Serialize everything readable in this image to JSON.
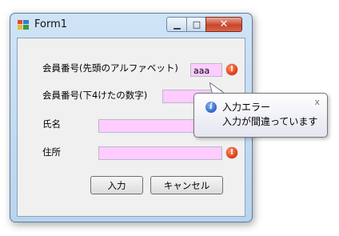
{
  "window": {
    "title": "Form1",
    "minimize_glyph": "▁",
    "maximize_glyph": "□",
    "close_glyph": "✕"
  },
  "form": {
    "member_id_prefix_label": "会員番号(先頭のアルファベット)",
    "member_id_prefix_value": "aaa",
    "member_id_digits_label": "会員番号(下4けたの数字)",
    "member_id_digits_value": "",
    "name_label": "氏名",
    "name_value": "",
    "address_label": "住所",
    "address_value": ""
  },
  "icons": {
    "error": "error-icon",
    "info": "info-icon",
    "error_glyph": "!",
    "info_glyph": "i"
  },
  "buttons": {
    "input_label": "入力",
    "cancel_label": "キャンセル"
  },
  "tooltip": {
    "title": "入力エラー",
    "message": "入力が間違っています",
    "close_glyph": "x"
  },
  "colors": {
    "field_background": "#ffccff",
    "error_icon": "#e3411c",
    "close_button": "#c8452c"
  }
}
